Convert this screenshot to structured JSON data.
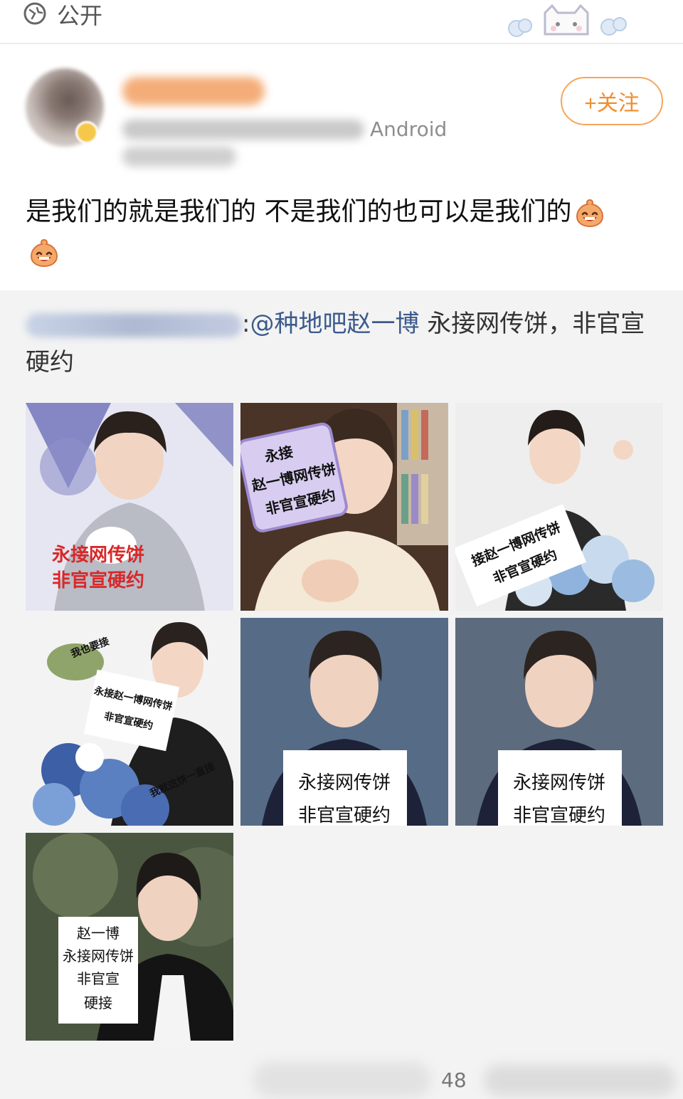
{
  "header": {
    "visibility_label": "公开"
  },
  "author": {
    "device": "Android",
    "follow_label": "+关注"
  },
  "post": {
    "text": "是我们的就是我们的 不是我们的也可以是我们的"
  },
  "repost": {
    "mention": "@种地吧赵一博",
    "text_after": " 永接网传饼，非官宣硬约",
    "colon": ":",
    "images": [
      {
        "caption_lines": [
          "永接网传饼",
          "非官宣硬约"
        ]
      },
      {
        "caption_lines": [
          "永接",
          "赵一博网传饼",
          "非官宣硬约"
        ]
      },
      {
        "caption_lines": [
          "接赵一博网传饼",
          "非官宣硬约"
        ]
      },
      {
        "caption_lines": [
          "我也要接",
          "永接赵一博网传饼",
          "非官宣硬约",
          "我就这饼一直接"
        ]
      },
      {
        "caption_lines": [
          "永接网传饼",
          "非官宣硬约"
        ]
      },
      {
        "caption_lines": [
          "永接网传饼",
          "非官宣硬约"
        ]
      },
      {
        "caption_lines": [
          "赵一博",
          "永接网传饼",
          "非官宣",
          "硬接"
        ]
      }
    ]
  },
  "footer": {
    "count": "48"
  },
  "colors": {
    "accent_orange": "#f08d2e",
    "mention_blue": "#3b5a8c",
    "repost_bg": "#f3f3f3"
  }
}
